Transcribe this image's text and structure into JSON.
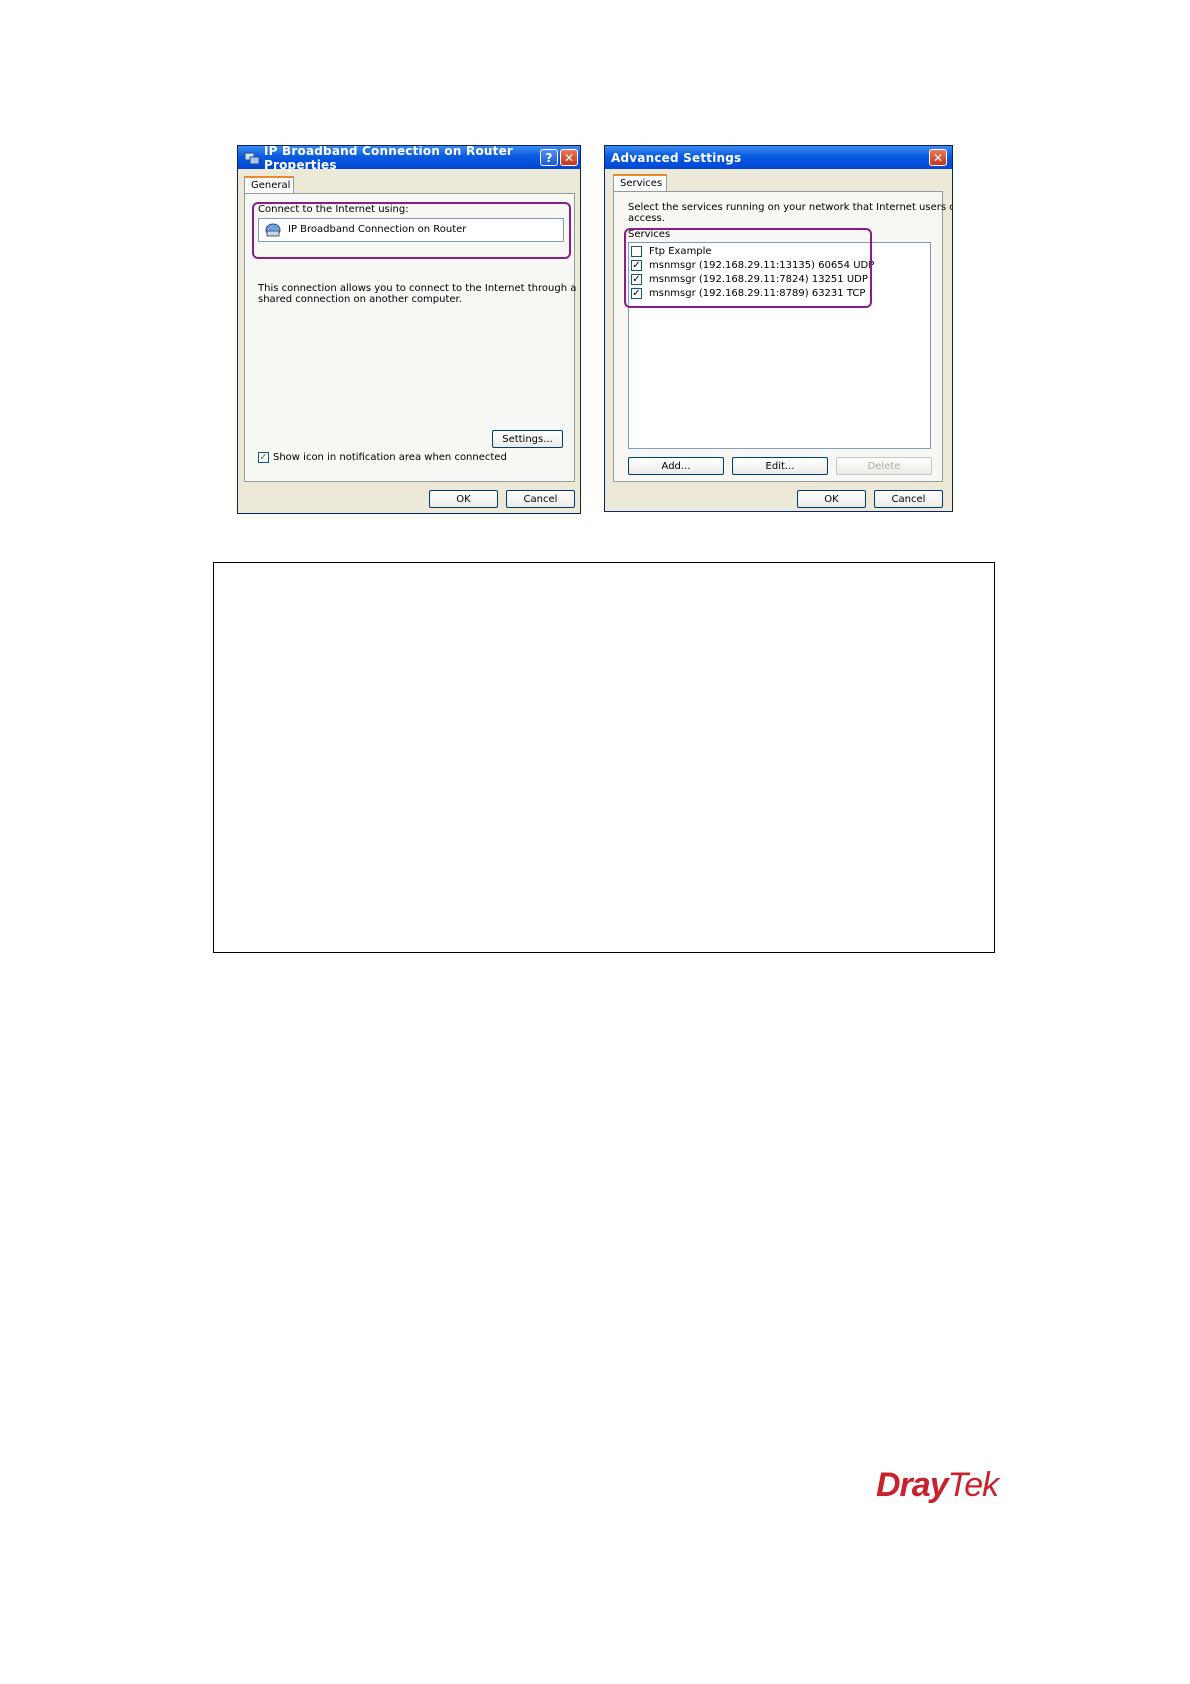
{
  "dialog1": {
    "title": "IP Broadband Connection on Router Properties",
    "help_label": "?",
    "close_label": "✕",
    "tab_label": "General",
    "connect_label": "Connect to the Internet using:",
    "connection_name": "IP Broadband Connection on Router",
    "description_line1": "This connection allows you to connect to the Internet through a",
    "description_line2": "shared connection on another computer.",
    "settings_label": "Settings...",
    "show_icon_label": "Show icon in notification area when connected",
    "show_icon_checked": true,
    "ok_label": "OK",
    "cancel_label": "Cancel"
  },
  "dialog2": {
    "title": "Advanced Settings",
    "close_label": "✕",
    "tab_label": "Services",
    "instruction_line1": "Select the services running on your network that Internet users can",
    "instruction_line2": "access.",
    "services_label": "Services",
    "services": [
      {
        "label": "Ftp Example",
        "checked": false
      },
      {
        "label": "msnmsgr (192.168.29.11:13135) 60654 UDP",
        "checked": true
      },
      {
        "label": "msnmsgr (192.168.29.11:7824) 13251 UDP",
        "checked": true
      },
      {
        "label": "msnmsgr (192.168.29.11:8789) 63231 TCP",
        "checked": true
      }
    ],
    "add_label": "Add...",
    "edit_label": "Edit...",
    "delete_label": "Delete",
    "ok_label": "OK",
    "cancel_label": "Cancel"
  },
  "logo": {
    "part1": "Dray",
    "part2": "Tek"
  },
  "colors": {
    "highlight": "#8b1c8b",
    "titlebar": "#0046d5",
    "logo": "#c8232c"
  }
}
